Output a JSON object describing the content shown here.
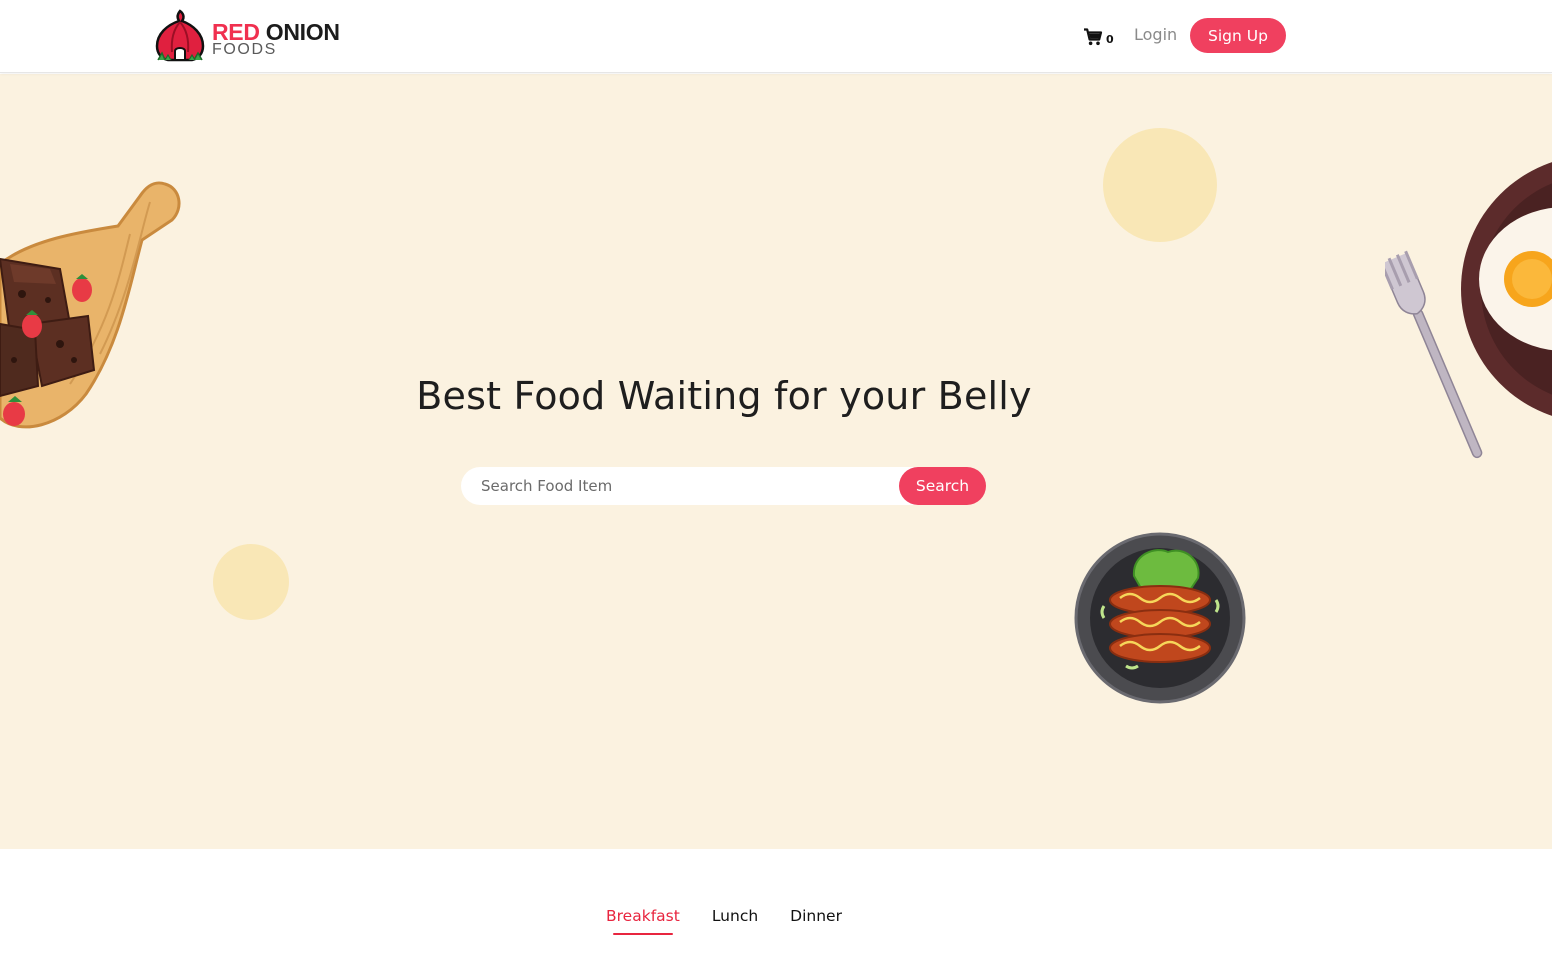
{
  "header": {
    "logo": {
      "word_red": "RED",
      "word_dark": "ONION",
      "sub": "FOODS"
    },
    "cart": {
      "icon": "cart-icon",
      "count": "0"
    },
    "login_label": "Login",
    "signup_label": "Sign Up"
  },
  "hero": {
    "title": "Best Food Waiting for your Belly",
    "search": {
      "placeholder": "Search Food Item",
      "value": "",
      "button_label": "Search"
    }
  },
  "tabs": [
    {
      "label": "Breakfast",
      "active": true
    },
    {
      "label": "Lunch",
      "active": false
    },
    {
      "label": "Dinner",
      "active": false
    }
  ],
  "colors": {
    "accent": "#f0405f",
    "active_tab": "#e8253f",
    "hero_bg": "#fbf2e0",
    "deco_circle": "#f9e7b6"
  }
}
